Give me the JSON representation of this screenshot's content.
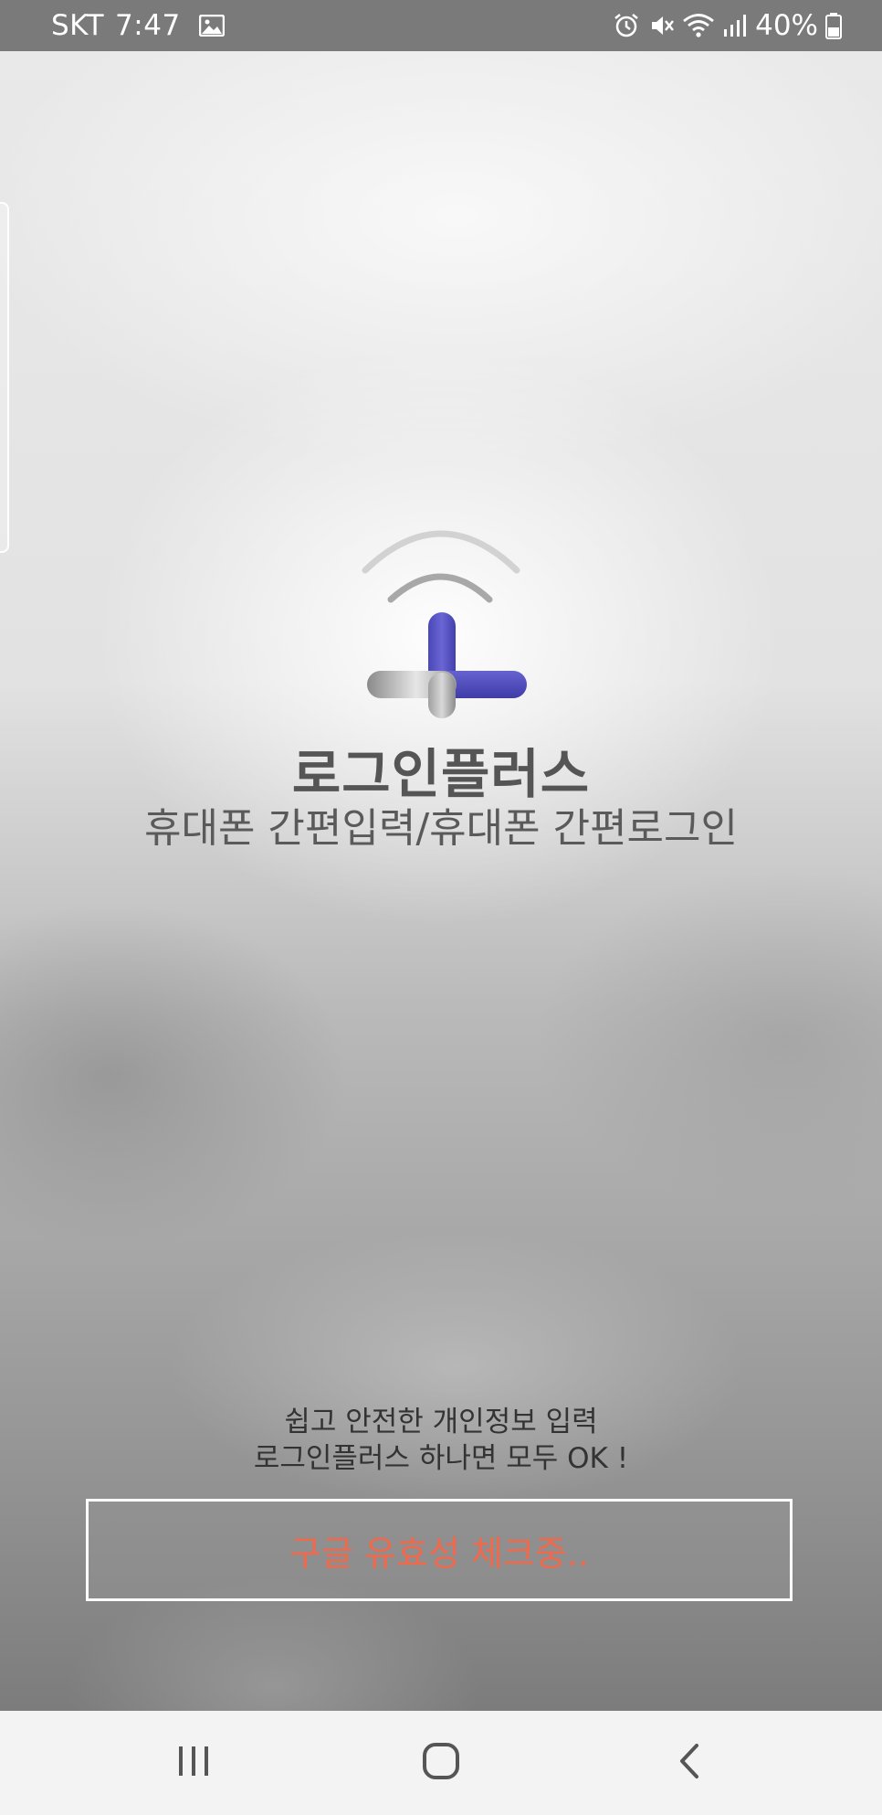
{
  "status_bar": {
    "carrier": "SKT",
    "time": "7:47",
    "battery_percent": "40%",
    "icons": [
      "gallery-icon",
      "alarm-icon",
      "mute-icon",
      "wifi-icon",
      "signal-icon",
      "battery-icon"
    ]
  },
  "splash": {
    "title": "로그인플러스",
    "subtitle": "휴대폰 간편입력/휴대폰 간편로그인",
    "tagline_line1": "쉽고 안전한 개인정보 입력",
    "tagline_line2": "로그인플러스 하나면 모두 OK !",
    "check_button_label": "구글 유효성 체크중..",
    "logo_icon": "login-plus-logo-icon"
  },
  "nav_bar": {
    "icons": [
      "recent-apps-icon",
      "home-icon",
      "back-icon"
    ]
  },
  "colors": {
    "accent_purple": "#5855c4",
    "button_text": "#ef6a4c",
    "title_text": "#555555"
  }
}
